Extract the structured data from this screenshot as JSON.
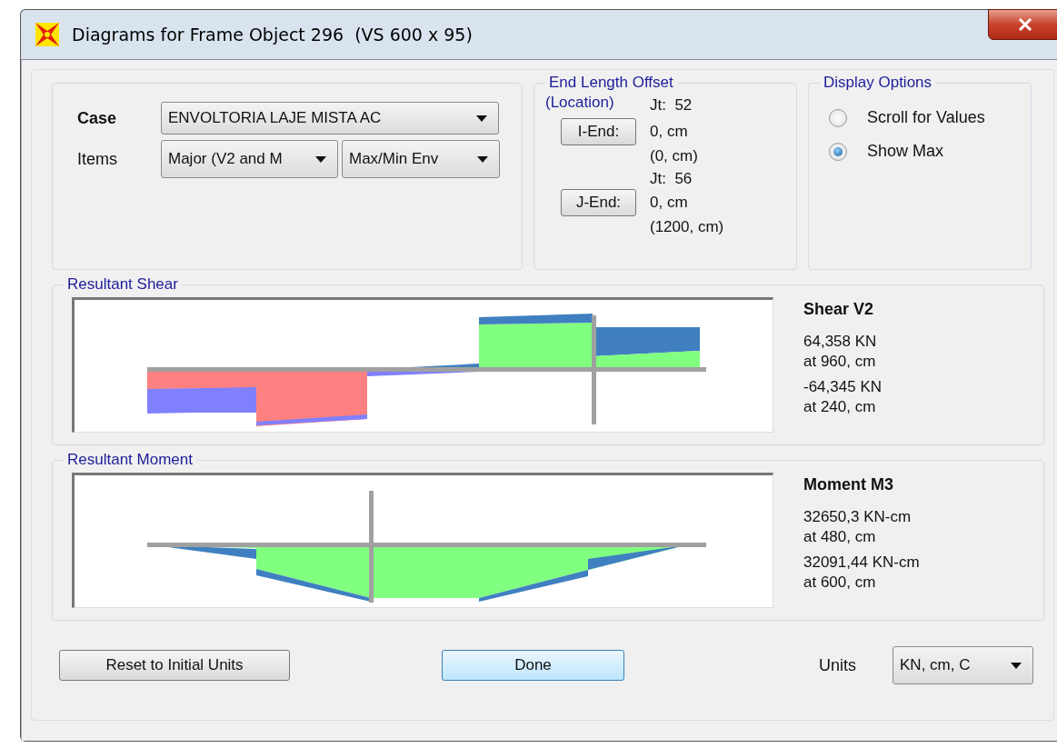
{
  "window": {
    "title": "Diagrams for Frame Object 296  (VS 600 x 95)"
  },
  "case_group": {
    "case_label": "Case",
    "case_value": "ENVOLTORIA LAJE MISTA AC",
    "items_label": "Items",
    "items_value": "Major (V2 and M",
    "component_value": "Max/Min Env"
  },
  "end_length_offset": {
    "title": "End Length Offset",
    "subtitle": "(Location)",
    "ends": [
      {
        "button": "I-End:",
        "joint": "Jt:  52",
        "offset": "0, cm",
        "location": "(0, cm)"
      },
      {
        "button": "J-End:",
        "joint": "Jt:  56",
        "offset": "0, cm",
        "location": "(1200, cm)"
      }
    ]
  },
  "display_options": {
    "title": "Display Options",
    "options": [
      {
        "label": "Scroll for Values",
        "selected": false
      },
      {
        "label": "Show Max",
        "selected": true
      }
    ]
  },
  "diagrams": [
    {
      "kind": "shear",
      "title": "Resultant Shear",
      "heading": "Shear V2",
      "results": [
        {
          "value": "64,358 KN",
          "location": "at 960, cm"
        },
        {
          "value": "-64,345 KN",
          "location": "at 240, cm"
        }
      ]
    },
    {
      "kind": "moment",
      "title": "Resultant Moment",
      "heading": "Moment M3",
      "results": [
        {
          "value": "32650,3 KN-cm",
          "location": "at 480, cm"
        },
        {
          "value": "32091,44 KN-cm",
          "location": "at 600, cm"
        }
      ]
    }
  ],
  "footer": {
    "reset_button": "Reset to Initial Units",
    "done_button": "Done",
    "units_label": "Units",
    "units_value": "KN, cm, C"
  }
}
